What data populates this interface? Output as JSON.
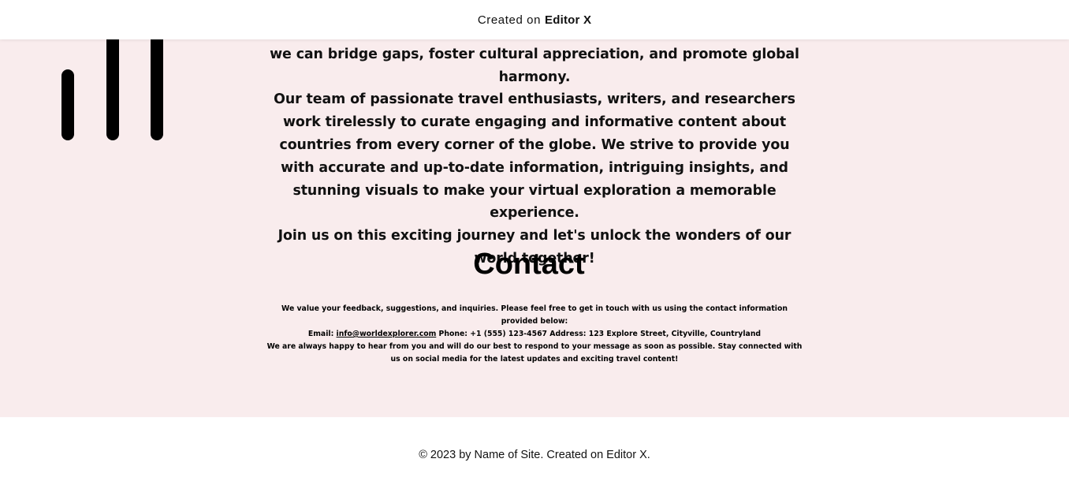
{
  "top_banner": {
    "prefix": "Created on",
    "brand": "Editor X"
  },
  "about": {
    "paragraphs": [
      "learning about different countries and their unique characteristics, we can bridge gaps, foster cultural appreciation, and promote global harmony.",
      "Our team of passionate travel enthusiasts, writers, and researchers work tirelessly to curate engaging and informative content about countries from every corner of the globe. We strive to provide you with accurate and up-to-date information, intriguing insights, and stunning visuals to make your virtual exploration a memorable experience.",
      "Join us on this exciting journey and let's unlock the wonders of our world together!"
    ]
  },
  "contact": {
    "title": "Contact",
    "intro": "We value your feedback, suggestions, and inquiries. Please feel free to get in touch with us using the contact information provided below:",
    "email_label": "Email:",
    "email": "info@worldexplorer.com",
    "phone_label": "Phone:",
    "phone": "+1 (555) 123-4567",
    "address_label": "Address:",
    "address": "123 Explore Street, Cityville, Countryland",
    "outro": "We are always happy to hear from you and will do our best to respond to your message as soon as possible. Stay connected with us on social media for the latest updates and exciting travel content!"
  },
  "footer": {
    "text": "© 2023 by Name of Site. Created on Editor X."
  },
  "colors": {
    "section_background": "#f9eced",
    "text": "#111111"
  }
}
